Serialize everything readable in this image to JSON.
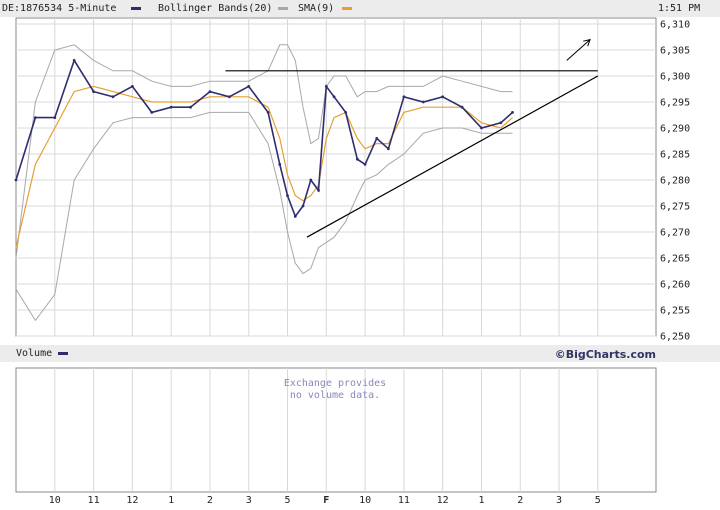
{
  "header": {
    "symbol_label": "DE:1876534 5-Minute",
    "bollinger_label": "Bollinger Bands(20)",
    "sma_label": "SMA(9)",
    "time": "1:51 PM"
  },
  "volume_panel": {
    "label": "Volume",
    "brand": "©BigCharts.com",
    "message_line1": "Exchange provides",
    "message_line2": "no volume data."
  },
  "colors": {
    "price": "#2e2e6e",
    "bollinger": "#a8a8a8",
    "sma": "#e6a030",
    "grid": "#d8d8d8",
    "trendline": "#000000"
  },
  "chart_data": {
    "type": "line",
    "ylim": [
      6250,
      6310
    ],
    "y_ticks": [
      "6,250",
      "6,255",
      "6,260",
      "6,265",
      "6,270",
      "6,275",
      "6,280",
      "6,285",
      "6,290",
      "6,295",
      "6,300",
      "6,305",
      "6,310"
    ],
    "x_ticks": [
      "10",
      "11",
      "12",
      "1",
      "2",
      "3",
      "5",
      "F",
      "10",
      "11",
      "12",
      "1",
      "2",
      "3",
      "5"
    ],
    "x_tick_values": [
      1,
      2,
      3,
      4,
      5,
      6,
      7,
      8,
      9,
      10,
      11,
      12,
      13,
      14,
      15
    ],
    "xlim": [
      0,
      16.5
    ],
    "grid": true,
    "series": [
      {
        "name": "DE:1876534 5-Minute",
        "x": [
          0,
          0.5,
          1,
          1.5,
          2,
          2.5,
          3,
          3.5,
          4,
          4.5,
          5,
          5.5,
          6,
          6.5,
          6.8,
          7.0,
          7.2,
          7.4,
          7.6,
          7.8,
          8,
          8.2,
          8.5,
          8.8,
          9,
          9.3,
          9.6,
          10,
          10.5,
          11,
          11.5,
          12,
          12.5,
          12.8
        ],
        "values": [
          6280,
          6292,
          6292,
          6303,
          6297,
          6296,
          6298,
          6293,
          6294,
          6294,
          6297,
          6296,
          6298,
          6293,
          6283,
          6277,
          6273,
          6275,
          6280,
          6278,
          6298,
          6296,
          6293,
          6284,
          6283,
          6288,
          6286,
          6296,
          6295,
          6296,
          6294,
          6290,
          6291,
          6293
        ]
      },
      {
        "name": "SMA(9)",
        "x": [
          0,
          0.5,
          1,
          1.5,
          2,
          2.5,
          3,
          3.5,
          4,
          4.5,
          5,
          5.5,
          6,
          6.5,
          6.8,
          7.0,
          7.2,
          7.4,
          7.6,
          7.8,
          8,
          8.2,
          8.5,
          8.8,
          9,
          9.3,
          9.6,
          10,
          10.5,
          11,
          11.5,
          12,
          12.5,
          12.8
        ],
        "values": [
          6267,
          6283,
          6290,
          6297,
          6298,
          6297,
          6296,
          6295,
          6295,
          6295,
          6296,
          6296,
          6296,
          6294,
          6288,
          6281,
          6277,
          6276,
          6277,
          6279,
          6288,
          6292,
          6293,
          6288,
          6286,
          6287,
          6287,
          6293,
          6294,
          6294,
          6294,
          6291,
          6290,
          6292
        ]
      },
      {
        "name": "Bollinger Bands(20)",
        "x": [
          0,
          0.5,
          1,
          1.5,
          2,
          2.5,
          3,
          3.5,
          4,
          4.5,
          5,
          5.5,
          6,
          6.5,
          6.8,
          7.0,
          7.2,
          7.4,
          7.6,
          7.8,
          8,
          8.2,
          8.5,
          8.8,
          9,
          9.3,
          9.6,
          10,
          10.5,
          11,
          11.5,
          12,
          12.5,
          12.8
        ],
        "values": [
          6265,
          6295,
          6305,
          6306,
          6303,
          6301,
          6301,
          6299,
          6298,
          6298,
          6299,
          6299,
          6299,
          6301,
          6306,
          6306,
          6303,
          6294,
          6287,
          6288,
          6298,
          6300,
          6300,
          6296,
          6297,
          6297,
          6298,
          6298,
          6298,
          6300,
          6299,
          6298,
          6297,
          6297
        ]
      },
      {
        "name": "Bollinger Bands(20)",
        "x": [
          0,
          0.5,
          1,
          1.5,
          2,
          2.5,
          3,
          3.5,
          4,
          4.5,
          5,
          5.5,
          6,
          6.5,
          6.8,
          7.0,
          7.2,
          7.4,
          7.6,
          7.8,
          8,
          8.2,
          8.5,
          8.8,
          9,
          9.3,
          9.6,
          10,
          10.5,
          11,
          11.5,
          12,
          12.5,
          12.8
        ],
        "values": [
          6259,
          6253,
          6258,
          6280,
          6286,
          6291,
          6292,
          6292,
          6292,
          6292,
          6293,
          6293,
          6293,
          6287,
          6278,
          6270,
          6264,
          6262,
          6263,
          6267,
          6268,
          6269,
          6272,
          6277,
          6280,
          6281,
          6283,
          6285,
          6289,
          6290,
          6290,
          6289,
          6289,
          6289
        ]
      }
    ],
    "annotations": [
      {
        "type": "resistance",
        "x": [
          5.4,
          15.0
        ],
        "values": [
          6301,
          6301
        ]
      },
      {
        "type": "support",
        "x": [
          7.5,
          15.0
        ],
        "values": [
          6269,
          6300
        ]
      },
      {
        "type": "arrow",
        "x": [
          14.2,
          14.8
        ],
        "values": [
          6303,
          6307
        ]
      }
    ]
  }
}
